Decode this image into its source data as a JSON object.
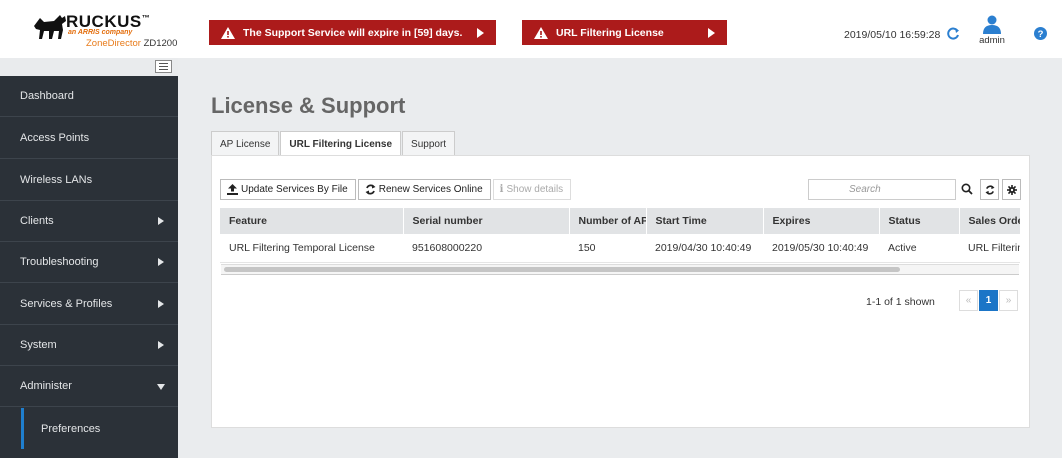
{
  "header": {
    "brand": "RUCKUS",
    "brand_tm": "™",
    "tagline": "an ARRIS company",
    "product": "ZoneDirector",
    "model": "ZD1200",
    "alerts": [
      {
        "text": "The Support Service will expire in [59] days."
      },
      {
        "text": "URL Filtering License"
      }
    ],
    "datetime": "2019/05/10  16:59:28",
    "user": "admin"
  },
  "sidebar": {
    "items": [
      {
        "label": "Dashboard",
        "expandable": false
      },
      {
        "label": "Access Points",
        "expandable": false
      },
      {
        "label": "Wireless LANs",
        "expandable": false
      },
      {
        "label": "Clients",
        "expandable": true
      },
      {
        "label": "Troubleshooting",
        "expandable": true
      },
      {
        "label": "Services & Profiles",
        "expandable": true
      },
      {
        "label": "System",
        "expandable": true
      },
      {
        "label": "Administer",
        "expandable": true,
        "expanded": true
      }
    ],
    "subitems": [
      {
        "label": "Preferences"
      }
    ]
  },
  "main": {
    "title": "License & Support",
    "tabs": [
      {
        "label": "AP License"
      },
      {
        "label": "URL Filtering License",
        "active": true
      },
      {
        "label": "Support"
      }
    ],
    "toolbar": {
      "update_label": "Update Services By File",
      "renew_label": "Renew Services Online",
      "details_label": "Show details",
      "search_placeholder": "Search"
    },
    "table": {
      "columns": [
        "Feature",
        "Serial number",
        "Number of AP",
        "Start Time",
        "Expires",
        "Status",
        "Sales Order"
      ],
      "rows": [
        [
          "URL Filtering Temporal License",
          "951608000220",
          "150",
          "2019/04/30 10:40:49",
          "2019/05/30 10:40:49",
          "Active",
          "URL Filtering"
        ]
      ]
    },
    "pagination": {
      "info": "1-1 of 1 shown",
      "prev": "«",
      "current": "1",
      "next": "»"
    }
  },
  "colors": {
    "alert_bg": "#ac1b1b",
    "sidebar_bg": "#2b3138",
    "accent": "#1b75c7"
  }
}
